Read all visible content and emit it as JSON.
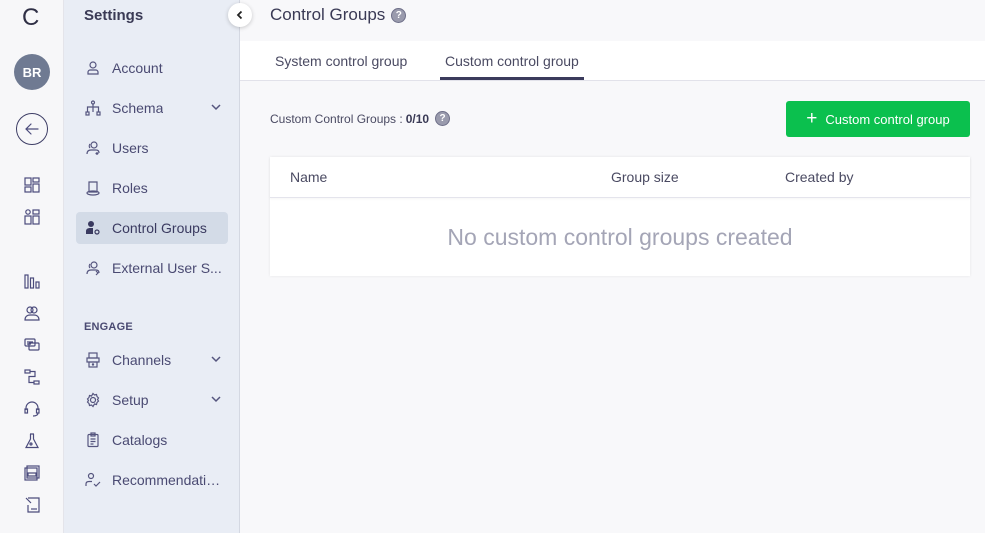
{
  "rail": {
    "logo": "C",
    "avatar_initials": "BR",
    "icons": [
      "back-arrow-icon",
      "dashboard-icon",
      "dashboard-users-icon",
      "analytics-icon",
      "segments-icon",
      "messages-icon",
      "journeys-icon",
      "support-icon",
      "experiments-icon",
      "content-icon",
      "reports-icon"
    ]
  },
  "sidebar": {
    "title": "Settings",
    "items": [
      {
        "label": "Account",
        "icon": "user-icon"
      },
      {
        "label": "Schema",
        "icon": "schema-icon",
        "expandable": true
      },
      {
        "label": "Users",
        "icon": "users-icon"
      },
      {
        "label": "Roles",
        "icon": "roles-icon"
      },
      {
        "label": "Control Groups",
        "icon": "control-group-icon",
        "active": true
      },
      {
        "label": "External User S...",
        "icon": "external-users-icon"
      }
    ],
    "section_label": "ENGAGE",
    "engage_items": [
      {
        "label": "Channels",
        "icon": "channels-icon",
        "expandable": true
      },
      {
        "label": "Setup",
        "icon": "gear-icon",
        "expandable": true
      },
      {
        "label": "Catalogs",
        "icon": "catalog-icon"
      },
      {
        "label": "Recommendatio...",
        "icon": "recommendation-icon"
      }
    ]
  },
  "header": {
    "title": "Control Groups",
    "help": "?"
  },
  "tabs": [
    {
      "label": "System control group",
      "active": false
    },
    {
      "label": "Custom control group",
      "active": true
    }
  ],
  "counter": {
    "label": "Custom Control Groups :",
    "value": "0/10",
    "help": "?"
  },
  "add_button": {
    "icon": "+",
    "label": "Custom control group"
  },
  "table": {
    "columns": [
      "Name",
      "Group size",
      "Created by"
    ],
    "rows": [],
    "empty_message": "No custom control groups created"
  },
  "colors": {
    "accent_green": "#0bc04e",
    "active_tab_underline": "#3b3b5c",
    "sidebar_bg": "#e9edf5",
    "sidebar_active": "#d3dbe7"
  }
}
